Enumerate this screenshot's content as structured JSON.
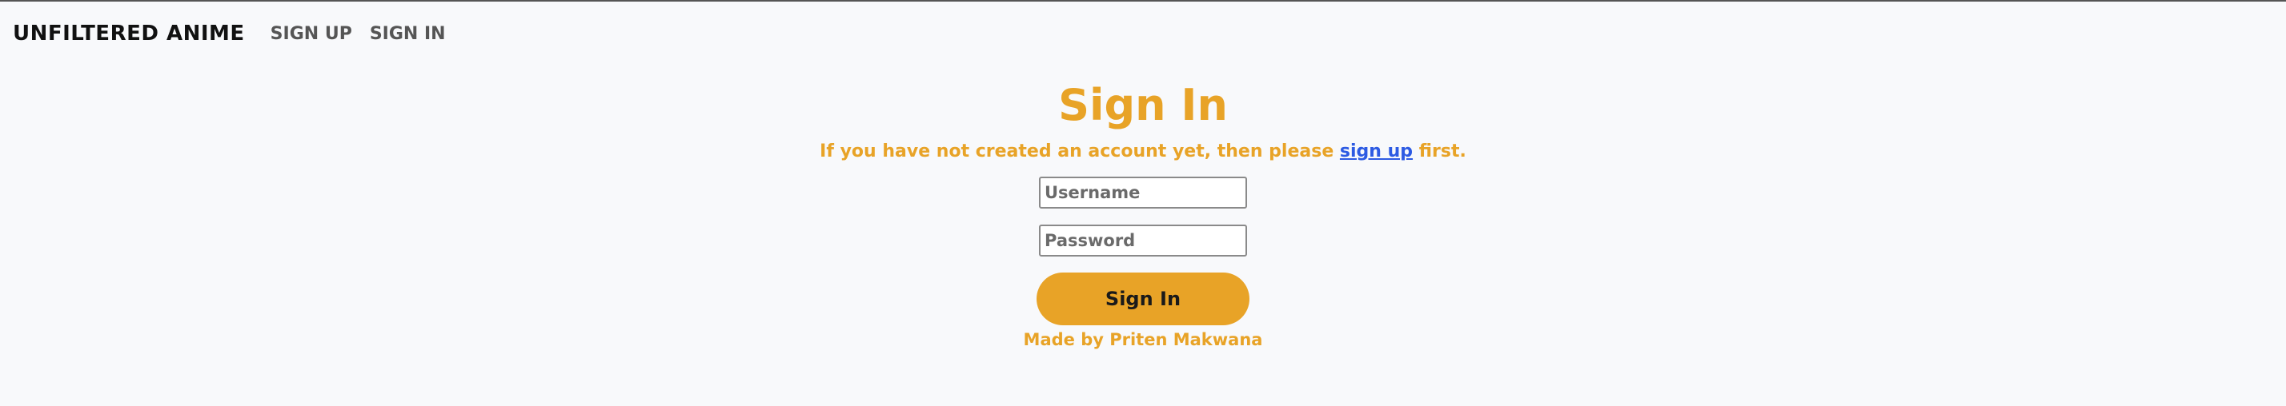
{
  "nav": {
    "brand": "UNFILTERED ANIME",
    "links": [
      "SIGN UP",
      "SIGN IN"
    ]
  },
  "signin": {
    "title": "Sign In",
    "subtitle_before": "If you have not created an account yet, then please ",
    "subtitle_link": "sign up",
    "subtitle_after": " first.",
    "username_placeholder": "Username",
    "password_placeholder": "Password",
    "submit_label": "Sign In"
  },
  "footer": {
    "credit": "Made by Priten Makwana"
  },
  "colors": {
    "accent": "#e8a327",
    "link": "#2d5be3",
    "background": "#f8f9fb"
  }
}
